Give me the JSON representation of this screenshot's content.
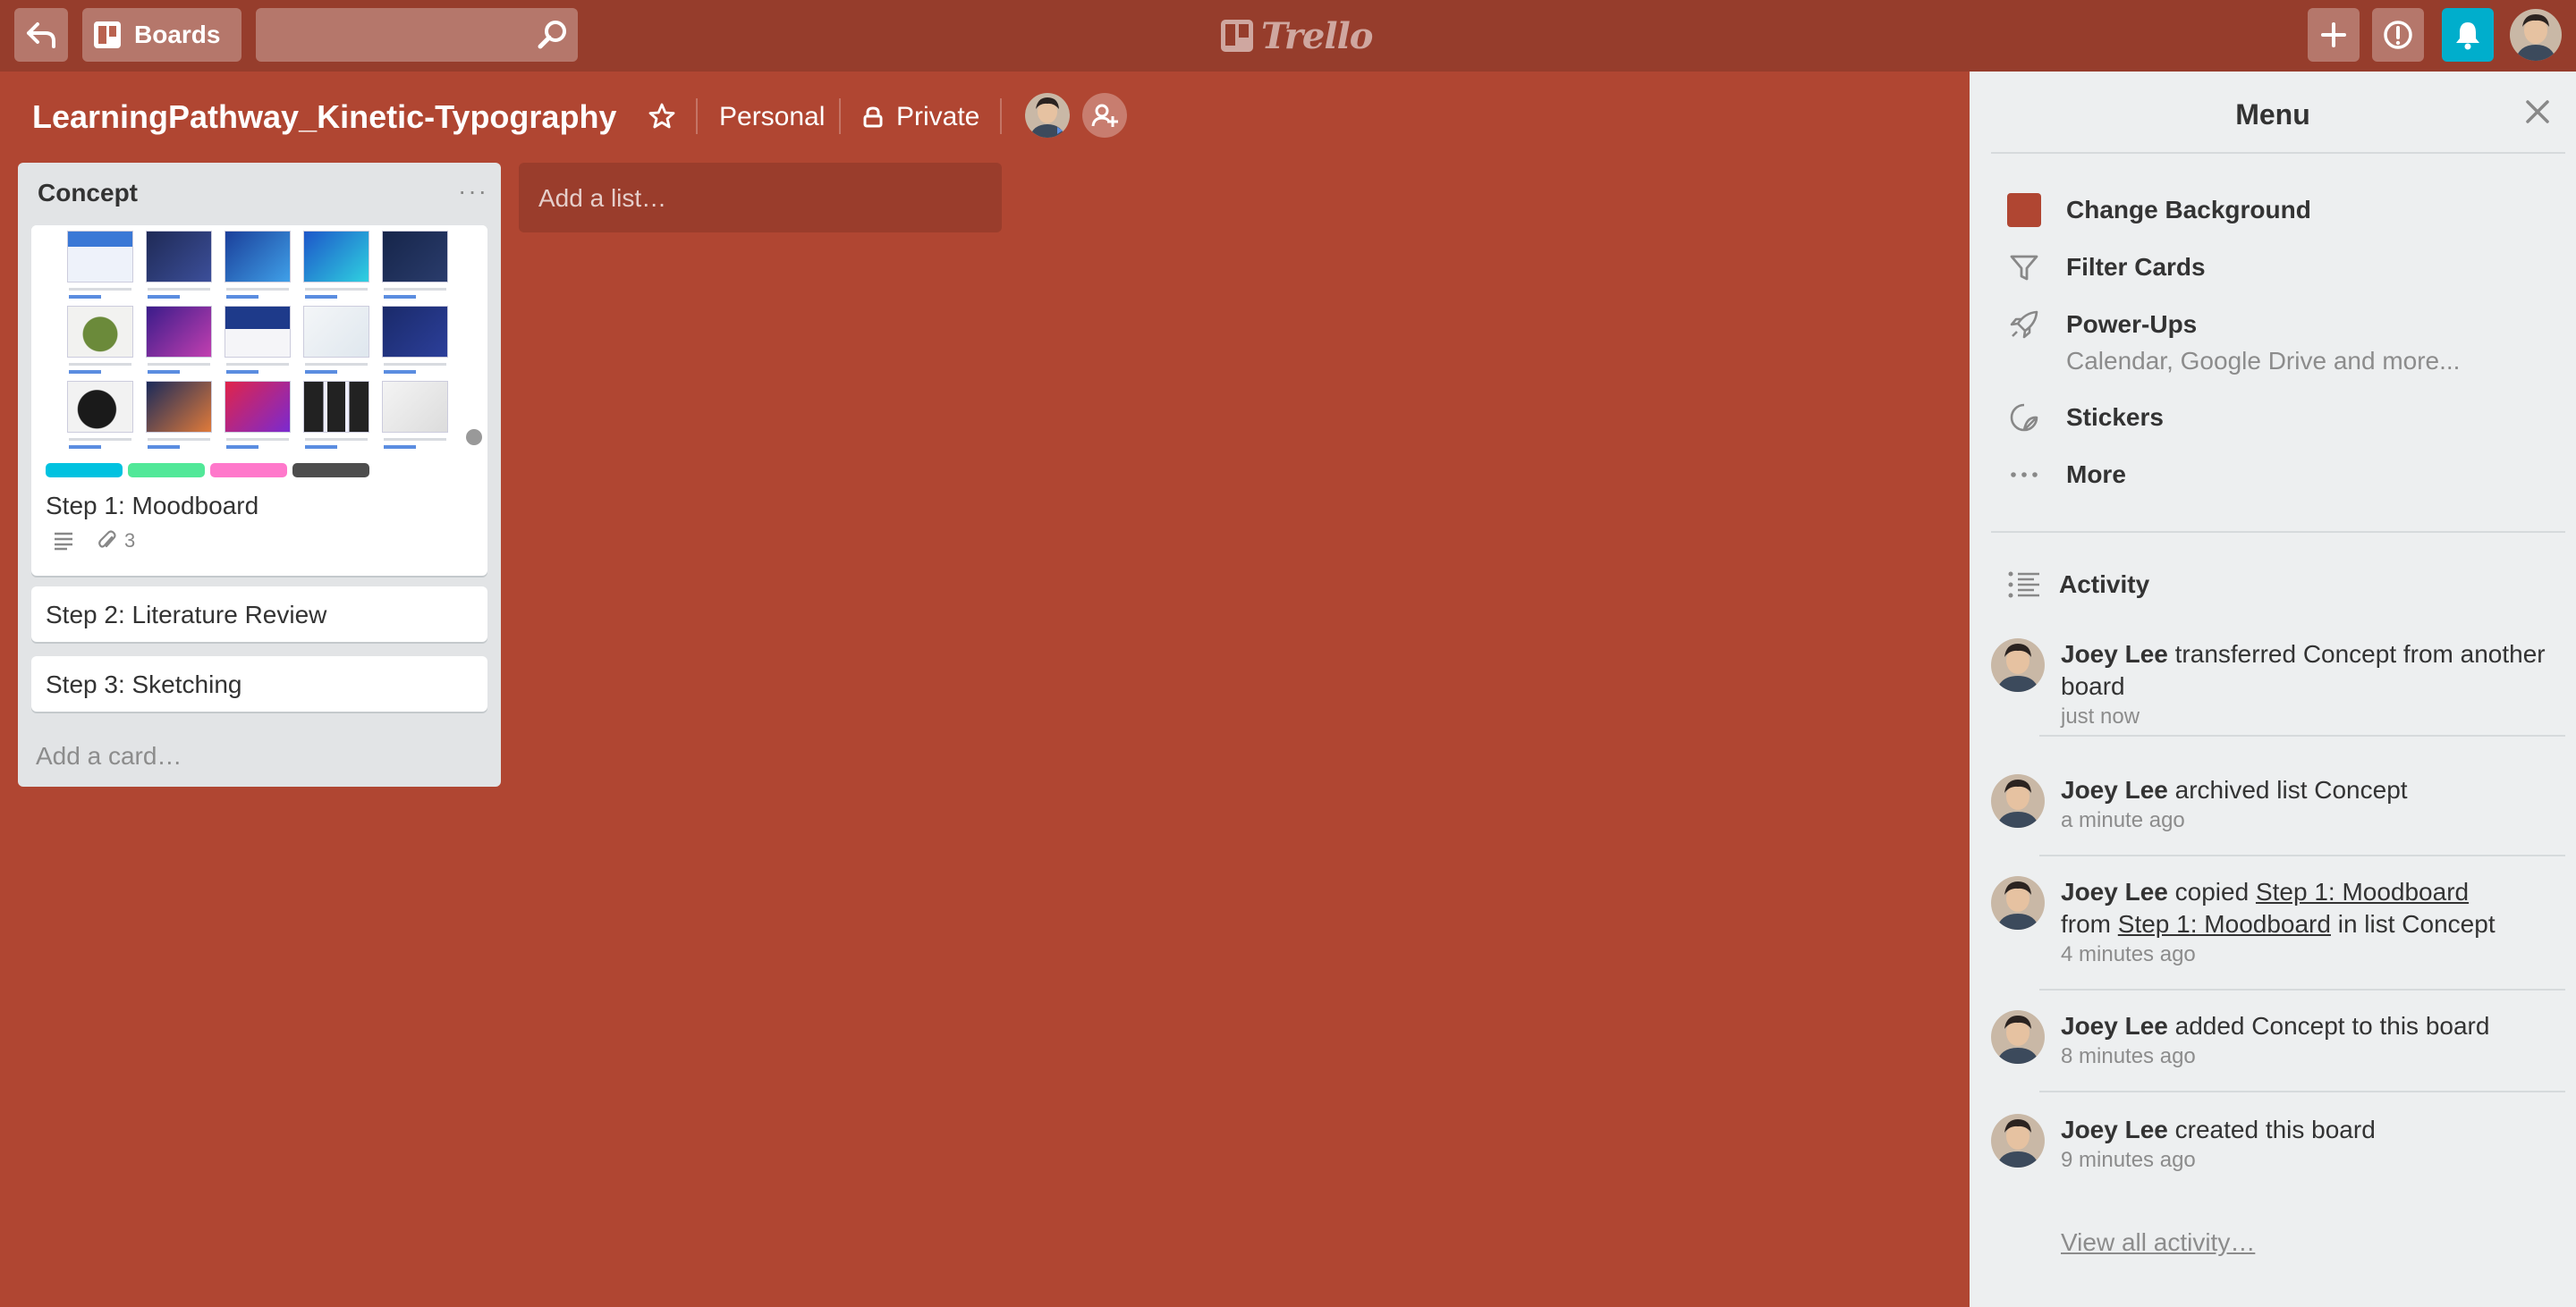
{
  "header": {
    "boards_label": "Boards",
    "search_placeholder": "",
    "logo_text": "Trello"
  },
  "board": {
    "title": "LearningPathway_Kinetic-Typography",
    "team": "Personal",
    "visibility": "Private"
  },
  "lists": [
    {
      "title": "Concept",
      "menu_label": "···",
      "cards": [
        {
          "title": "Step 1: Moodboard",
          "label_colors": [
            "#00c2e0",
            "#51e898",
            "#ff78cb",
            "#4d4d4d"
          ],
          "attachments": "3",
          "has_description": true
        },
        {
          "title": "Step 2: Literature Review"
        },
        {
          "title": "Step 3: Sketching"
        }
      ],
      "add_card": "Add a card…"
    }
  ],
  "add_list": "Add a list…",
  "menu": {
    "title": "Menu",
    "items": [
      {
        "label": "Change Background",
        "icon": "color-swatch"
      },
      {
        "label": "Filter Cards",
        "icon": "filter-icon"
      },
      {
        "label": "Power-Ups",
        "icon": "rocket-icon",
        "sub": "Calendar, Google Drive and more..."
      },
      {
        "label": "Stickers",
        "icon": "sticker-icon"
      },
      {
        "label": "More",
        "icon": "more-icon"
      }
    ],
    "activity_title": "Activity",
    "activity": [
      {
        "user": "Joey Lee",
        "text": "transferred Concept from another board",
        "time": "just now"
      },
      {
        "user": "Joey Lee",
        "text": "archived list Concept",
        "time": "a minute ago"
      },
      {
        "user": "Joey Lee",
        "text_pre": "copied",
        "link1": "Step 1: Moodboard",
        "text_mid": "from",
        "link2": "Step 1: Moodboard",
        "text_post": "in list Concept",
        "time": "4 minutes ago"
      },
      {
        "user": "Joey Lee",
        "text": "added Concept to this board",
        "time": "8 minutes ago"
      },
      {
        "user": "Joey Lee",
        "text": "created this board",
        "time": "9 minutes ago"
      }
    ],
    "view_all": "View all activity…"
  },
  "colors": {
    "board_bg": "#b04632",
    "header_bg": "#963d2c",
    "notification": "#00aecc"
  }
}
